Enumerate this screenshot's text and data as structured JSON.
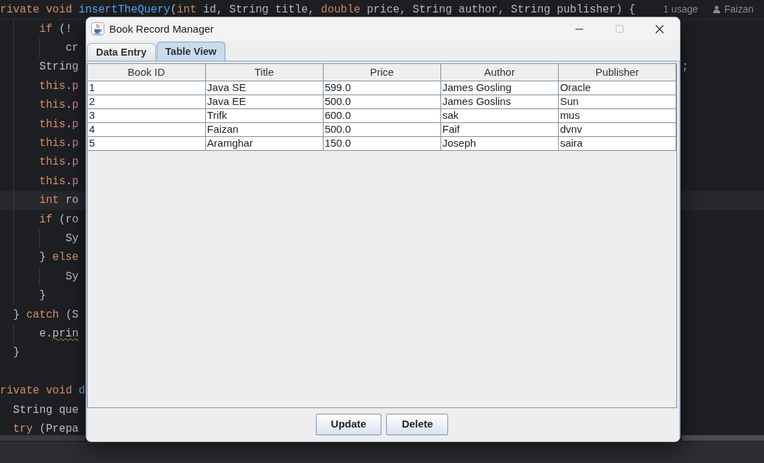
{
  "editor": {
    "sticky_line": {
      "tokens": [
        {
          "kind": "keyword",
          "text": "rivate void "
        },
        {
          "kind": "method",
          "text": "insertTheQuery"
        },
        {
          "kind": "text",
          "text": "("
        },
        {
          "kind": "keyword",
          "text": "int"
        },
        {
          "kind": "text",
          "text": " id, String title, "
        },
        {
          "kind": "keyword",
          "text": "double"
        },
        {
          "kind": "text",
          "text": " price, String author, String publisher) {"
        }
      ],
      "usages": "1 usage",
      "author": "Faizan"
    },
    "lines": [
      {
        "current": false,
        "tokens": [
          {
            "kind": "keyword",
            "text": "      if"
          },
          {
            "kind": "text",
            "text": " (!"
          }
        ]
      },
      {
        "current": false,
        "tokens": [
          {
            "kind": "text",
            "text": "          cr"
          }
        ]
      },
      {
        "current": false,
        "tokens": [
          {
            "kind": "text",
            "text": "      String"
          }
        ],
        "right": [
          {
            "kind": "text",
            "text": ";"
          }
        ]
      },
      {
        "current": false,
        "tokens": [
          {
            "kind": "keyword",
            "text": "      this"
          },
          {
            "kind": "text",
            "text": "."
          },
          {
            "kind": "field",
            "text": "p"
          }
        ]
      },
      {
        "current": false,
        "tokens": [
          {
            "kind": "keyword",
            "text": "      this"
          },
          {
            "kind": "text",
            "text": "."
          },
          {
            "kind": "field",
            "text": "p"
          }
        ]
      },
      {
        "current": false,
        "tokens": [
          {
            "kind": "keyword",
            "text": "      this"
          },
          {
            "kind": "text",
            "text": "."
          },
          {
            "kind": "field",
            "text": "p"
          }
        ]
      },
      {
        "current": false,
        "tokens": [
          {
            "kind": "keyword",
            "text": "      this"
          },
          {
            "kind": "text",
            "text": "."
          },
          {
            "kind": "field",
            "text": "p"
          }
        ]
      },
      {
        "current": false,
        "tokens": [
          {
            "kind": "keyword",
            "text": "      this"
          },
          {
            "kind": "text",
            "text": "."
          },
          {
            "kind": "field",
            "text": "p"
          }
        ]
      },
      {
        "current": false,
        "tokens": [
          {
            "kind": "keyword",
            "text": "      this"
          },
          {
            "kind": "text",
            "text": "."
          },
          {
            "kind": "field",
            "text": "p"
          }
        ]
      },
      {
        "current": true,
        "tokens": [
          {
            "kind": "keyword",
            "text": "      int"
          },
          {
            "kind": "text",
            "text": " ro"
          }
        ]
      },
      {
        "current": false,
        "tokens": [
          {
            "kind": "keyword",
            "text": "      if"
          },
          {
            "kind": "text",
            "text": " (ro"
          }
        ]
      },
      {
        "current": false,
        "tokens": [
          {
            "kind": "text",
            "text": "          Sy"
          }
        ]
      },
      {
        "current": false,
        "tokens": [
          {
            "kind": "text",
            "text": "      } "
          },
          {
            "kind": "keyword",
            "text": "else"
          }
        ]
      },
      {
        "current": false,
        "tokens": [
          {
            "kind": "text",
            "text": "          Sy"
          }
        ]
      },
      {
        "current": false,
        "tokens": [
          {
            "kind": "text",
            "text": "      }"
          }
        ]
      },
      {
        "current": false,
        "tokens": [
          {
            "kind": "text",
            "text": "  } "
          },
          {
            "kind": "keyword",
            "text": "catch"
          },
          {
            "kind": "text",
            "text": " (S"
          }
        ]
      },
      {
        "current": false,
        "tokens": [
          {
            "kind": "text",
            "text": "      e."
          },
          {
            "kind": "warned",
            "text": "prin"
          }
        ]
      },
      {
        "current": false,
        "tokens": [
          {
            "kind": "text",
            "text": "  }"
          }
        ]
      },
      {
        "current": false
      },
      {
        "current": false,
        "tokens": [
          {
            "kind": "keyword",
            "text": "rivate void "
          },
          {
            "kind": "method",
            "text": "d"
          }
        ]
      },
      {
        "current": false,
        "tokens": [
          {
            "kind": "text",
            "text": "  String que"
          }
        ]
      },
      {
        "current": false,
        "tokens": [
          {
            "kind": "keyword",
            "text": "  try"
          },
          {
            "kind": "text",
            "text": " (Prepa"
          }
        ]
      }
    ]
  },
  "window": {
    "title": "Book Record Manager",
    "controls": [
      {
        "kind": "minimize",
        "disabled": false
      },
      {
        "kind": "maximize",
        "disabled": true
      },
      {
        "kind": "close",
        "disabled": false
      }
    ],
    "tabs": [
      {
        "label": "Data Entry",
        "selected": false
      },
      {
        "label": "Table View",
        "selected": true
      }
    ],
    "table": {
      "columns": [
        "Book ID",
        "Title",
        "Price",
        "Author",
        "Publisher"
      ],
      "rows": [
        [
          "1",
          "Java SE",
          "599.0",
          "James Gosling",
          "Oracle"
        ],
        [
          "2",
          "Java EE",
          "500.0",
          "James Goslins",
          "Sun"
        ],
        [
          "3",
          "Trifk",
          "600.0",
          "sak",
          "mus"
        ],
        [
          "4",
          "Faizan",
          "500.0",
          "Faif",
          "dvnv"
        ],
        [
          "5",
          "Aramghar",
          "150.0",
          "Joseph",
          "saira"
        ]
      ]
    },
    "buttons": [
      "Update",
      "Delete"
    ]
  }
}
